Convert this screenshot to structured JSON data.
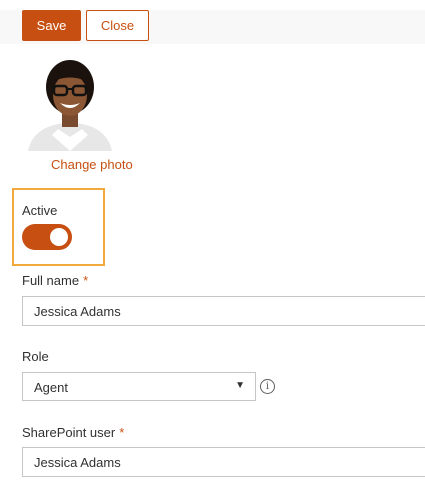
{
  "toolbar": {
    "save_label": "Save",
    "close_label": "Close"
  },
  "profile": {
    "change_photo_label": "Change photo"
  },
  "status": {
    "label": "Active",
    "toggle_on": true
  },
  "fields": {
    "full_name": {
      "label": "Full name",
      "required_mark": "*",
      "value": "Jessica Adams"
    },
    "role": {
      "label": "Role",
      "selected": "Agent",
      "info_icon": "info-icon"
    },
    "sharepoint_user": {
      "label": "SharePoint user",
      "required_mark": "*",
      "value": "Jessica Adams"
    }
  },
  "colors": {
    "accent": "#c74f11",
    "focus_outline": "#f2a93b",
    "toolbar_bg": "#f8f8f8",
    "input_border": "#c8c6c4"
  }
}
